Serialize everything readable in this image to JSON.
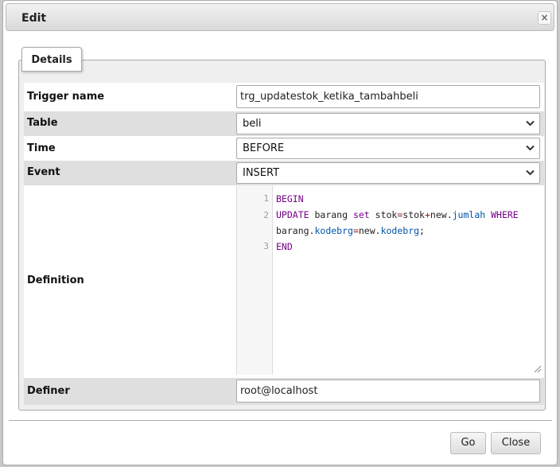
{
  "dialog": {
    "title": "Edit",
    "close_glyph": "×"
  },
  "tab": {
    "label": "Details"
  },
  "fields": {
    "trigger_name": {
      "label": "Trigger name",
      "value": "trg_updatestok_ketika_tambahbeli"
    },
    "table": {
      "label": "Table",
      "value": "beli"
    },
    "time": {
      "label": "Time",
      "value": "BEFORE"
    },
    "event": {
      "label": "Event",
      "value": "INSERT"
    },
    "definition": {
      "label": "Definition",
      "line_numbers": [
        "1",
        "2",
        "3"
      ],
      "code": {
        "l1_kw": "BEGIN",
        "l2_kw_update": "UPDATE",
        "l2_table": " barang ",
        "l2_kw_set": "set",
        "l2_stok": " stok",
        "l2_eq": "=",
        "l2_stok2": "stok",
        "l2_plus": "+",
        "l2_new": "new.",
        "l2_jumlah": "jumlah",
        "l2_kw_where": " WHERE",
        "l2b_barang": "barang.",
        "l2b_kodebrg": "kodebrg",
        "l2b_eq": "=",
        "l2b_new": "new.",
        "l2b_kodebrg2": "kodebrg",
        "l2b_semi": ";",
        "l3_kw": "END"
      }
    },
    "definer": {
      "label": "Definer",
      "value": "root@localhost"
    }
  },
  "buttons": {
    "go": "Go",
    "close": "Close"
  },
  "icons": {
    "close": "close-icon",
    "chevron": "chevron-down-icon",
    "resize": "resize-handle-icon"
  },
  "colors": {
    "keyword": "#770088",
    "property": "#0055aa",
    "operator": "#981a1a"
  }
}
